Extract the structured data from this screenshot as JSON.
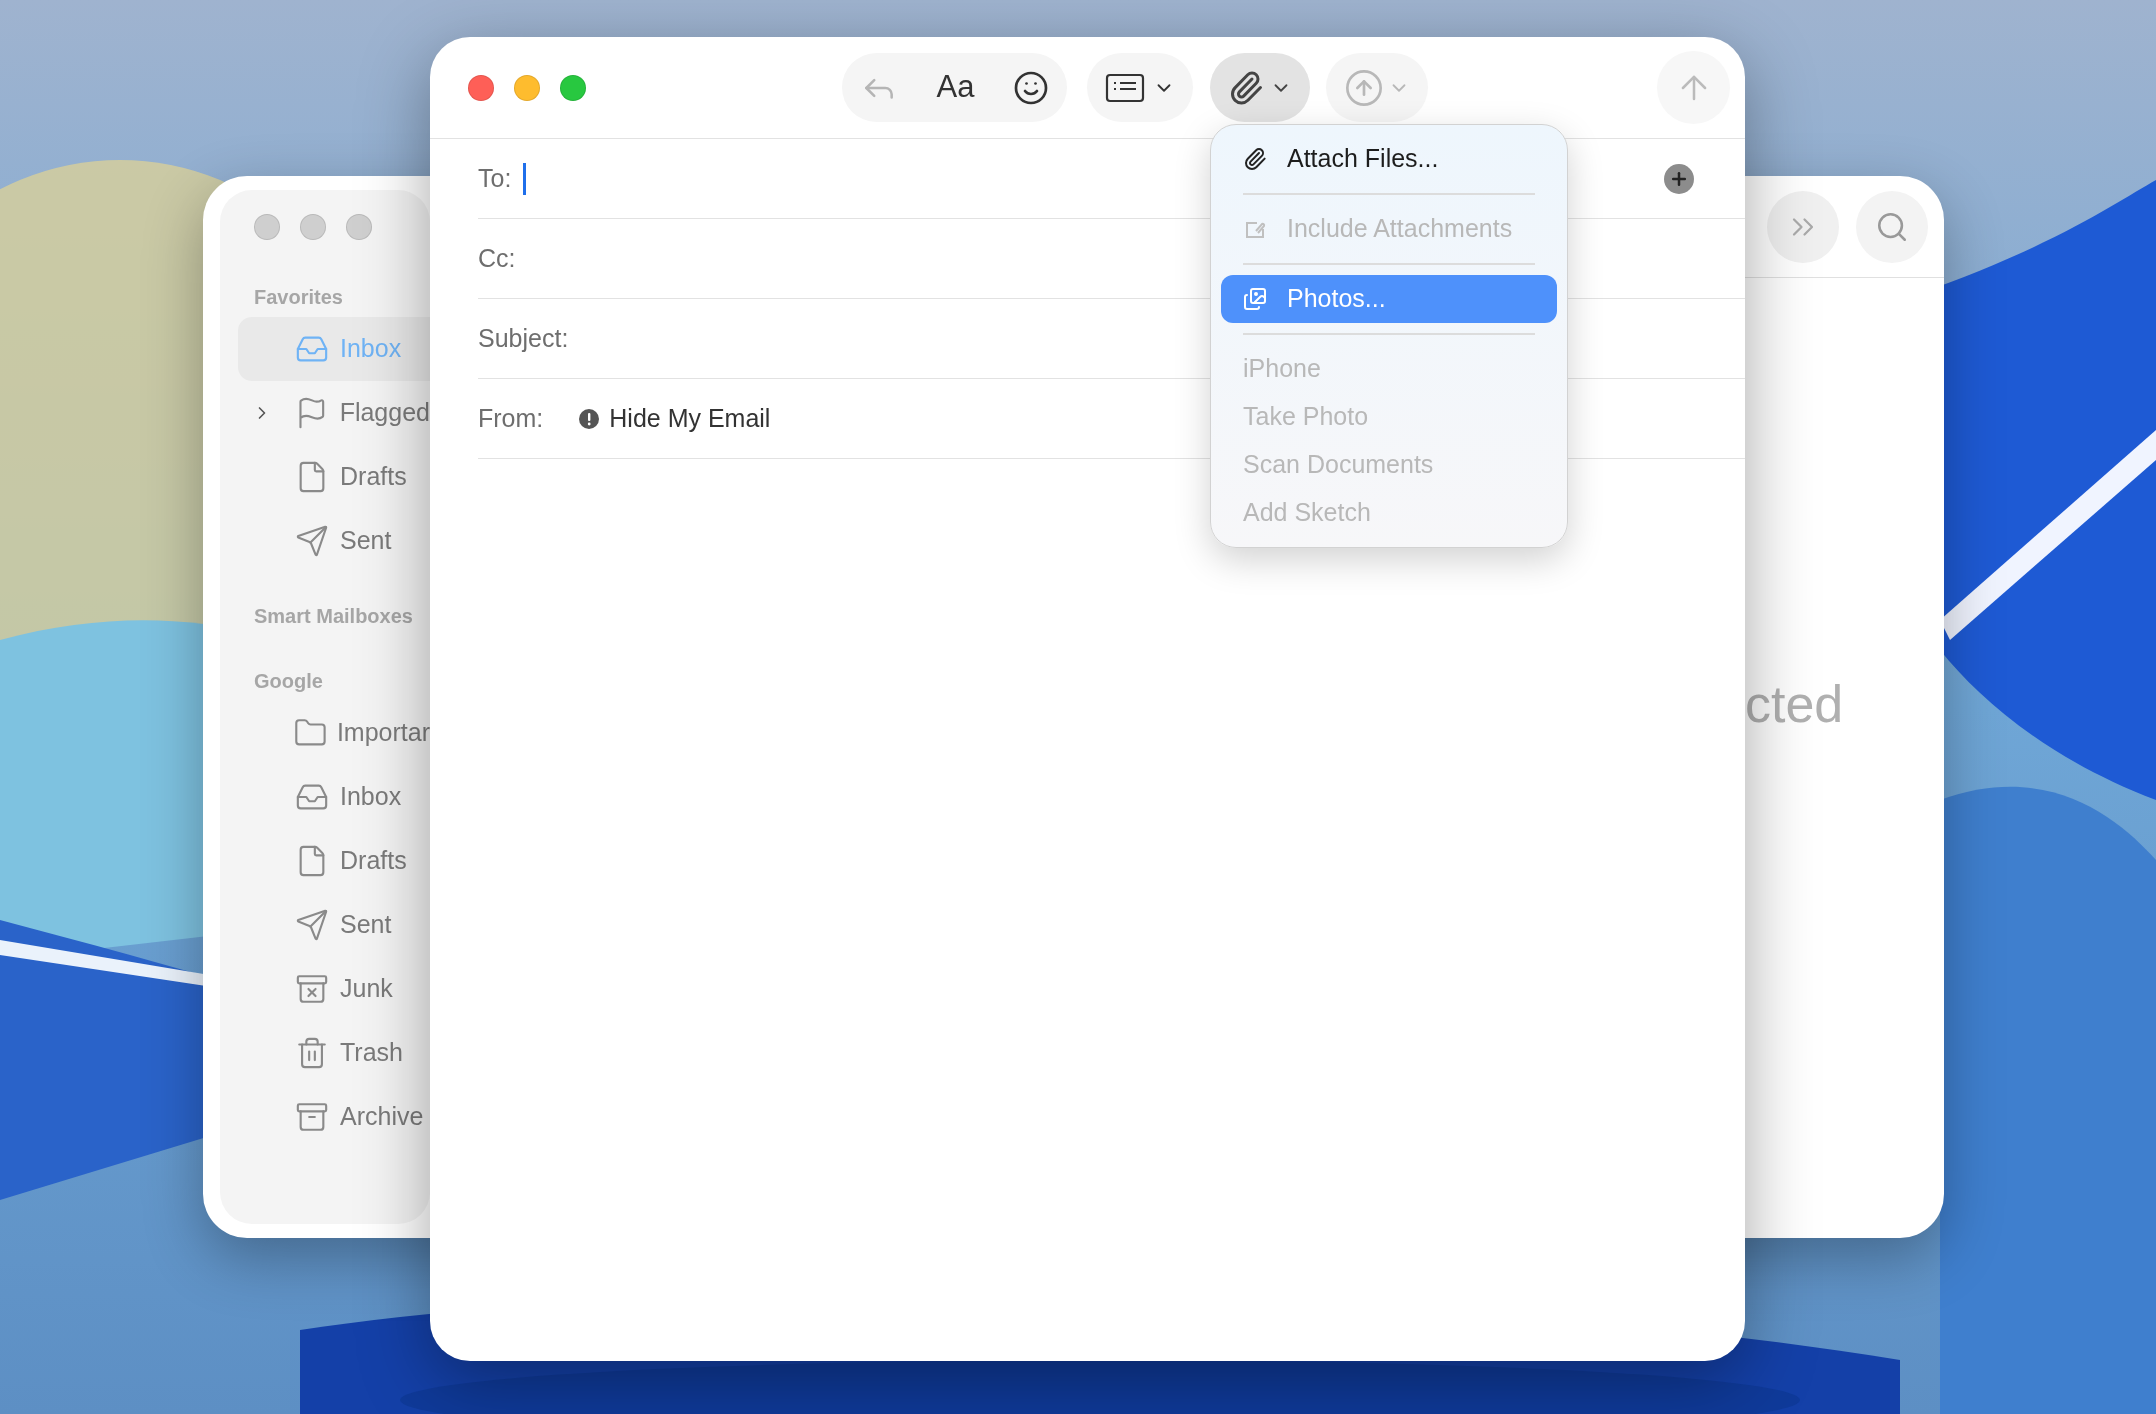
{
  "mailbox_window": {
    "sidebar": {
      "sections": [
        {
          "title": "Favorites",
          "items": [
            {
              "label": "Inbox",
              "kind": "inbox",
              "selected": true
            },
            {
              "label": "Flagged",
              "kind": "flag",
              "selected": false,
              "expanded": false
            },
            {
              "label": "Drafts",
              "kind": "draft",
              "selected": false
            },
            {
              "label": "Sent",
              "kind": "sent",
              "selected": false
            }
          ]
        },
        {
          "title": "Smart Mailboxes"
        },
        {
          "title": "Google",
          "items": [
            {
              "label": "Importar",
              "kind": "folder",
              "selected": false
            },
            {
              "label": "Inbox",
              "kind": "inbox",
              "selected": false
            },
            {
              "label": "Drafts",
              "kind": "draft",
              "selected": false
            },
            {
              "label": "Sent",
              "kind": "sent",
              "selected": false
            },
            {
              "label": "Junk",
              "kind": "junk",
              "selected": false
            },
            {
              "label": "Trash",
              "kind": "trash",
              "selected": false
            },
            {
              "label": "Archive",
              "kind": "archive",
              "selected": false
            }
          ]
        }
      ]
    },
    "message_view": {
      "placeholder": "cted"
    }
  },
  "compose_window": {
    "toolbar": {
      "format_label": "Aa",
      "attach_open": true
    },
    "fields": [
      {
        "label": "To:",
        "focused": true
      },
      {
        "label": "Cc:",
        "focused": false
      },
      {
        "label": "Subject:",
        "focused": false
      },
      {
        "label": "From:",
        "value": "Hide My Email",
        "focused": false
      }
    ],
    "attach_menu": [
      {
        "label": "Attach Files...",
        "kind": "attach",
        "disabled": false,
        "selected": false,
        "separator_after": true
      },
      {
        "label": "Include Attachments",
        "kind": "include",
        "disabled": true,
        "selected": false,
        "separator_after": true
      },
      {
        "label": "Photos...",
        "kind": "photos",
        "disabled": false,
        "selected": true,
        "separator_after": true
      },
      {
        "label": "iPhone",
        "kind": "plain",
        "disabled": true,
        "selected": false,
        "separator_after": false
      },
      {
        "label": "Take Photo",
        "kind": "plain",
        "disabled": true,
        "selected": false,
        "separator_after": false
      },
      {
        "label": "Scan Documents",
        "kind": "plain",
        "disabled": true,
        "selected": false,
        "separator_after": false
      },
      {
        "label": "Add Sketch",
        "kind": "plain",
        "disabled": true,
        "selected": false,
        "separator_after": false
      }
    ]
  }
}
